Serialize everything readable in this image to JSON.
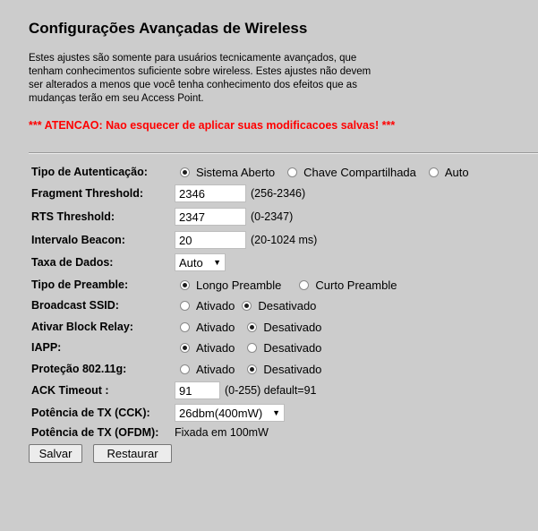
{
  "header": {
    "title": "Configurações Avançadas de Wireless",
    "intro": "Estes ajustes são somente para usuários tecnicamente avançados, que tenham conhecimentos suficiente sobre wireless. Estes ajustes não devem ser alterados a menos que você tenha conhecimento dos efeitos que as mudanças terão em seu Access Point.",
    "warning": "*** ATENCAO: Nao esquecer de aplicar suas modificacoes salvas! ***"
  },
  "form": {
    "auth": {
      "label": "Tipo de Autenticação:",
      "options": [
        "Sistema Aberto",
        "Chave Compartilhada",
        "Auto"
      ],
      "selected": "Sistema Aberto"
    },
    "fragment": {
      "label": "Fragment Threshold:",
      "value": "2346",
      "hint": "(256-2346)"
    },
    "rts": {
      "label": "RTS Threshold:",
      "value": "2347",
      "hint": "(0-2347)"
    },
    "beacon": {
      "label": "Intervalo Beacon:",
      "value": "20",
      "hint": "(20-1024 ms)"
    },
    "rate": {
      "label": "Taxa de Dados:",
      "value": "Auto"
    },
    "preamble": {
      "label": "Tipo de Preamble:",
      "options": [
        "Longo Preamble",
        "Curto Preamble"
      ],
      "selected": "Longo Preamble"
    },
    "ssid": {
      "label": "Broadcast SSID:",
      "options": [
        "Ativado",
        "Desativado"
      ],
      "selected": "Desativado"
    },
    "relay": {
      "label": "Ativar Block Relay:",
      "options": [
        "Ativado",
        "Desativado"
      ],
      "selected": "Desativado"
    },
    "iapp": {
      "label": "IAPP:",
      "options": [
        "Ativado",
        "Desativado"
      ],
      "selected": "Ativado"
    },
    "protection": {
      "label": "Proteção 802.11g:",
      "options": [
        "Ativado",
        "Desativado"
      ],
      "selected": "Desativado"
    },
    "ack": {
      "label": "ACK Timeout :",
      "value": "91",
      "hint": "(0-255) default=91"
    },
    "txcck": {
      "label": "Potência de TX (CCK):",
      "value": "26dbm(400mW)"
    },
    "txofdm": {
      "label": "Potência de TX (OFDM):",
      "value": "Fixada em 100mW"
    }
  },
  "buttons": {
    "save": "Salvar",
    "reset": "Restaurar"
  }
}
